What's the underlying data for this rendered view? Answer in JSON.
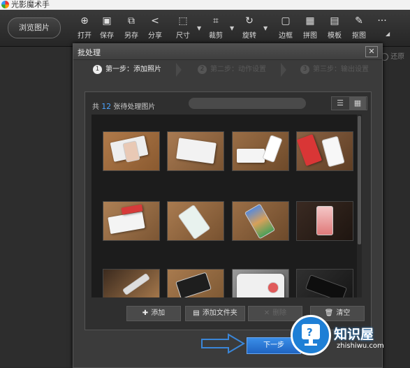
{
  "app": {
    "title": "光影魔术手"
  },
  "toolbar": {
    "browse_label": "浏览图片",
    "tools": [
      {
        "label": "打开",
        "icon": "open-icon",
        "glyph": "⊕"
      },
      {
        "label": "保存",
        "icon": "save-icon",
        "glyph": "▣"
      },
      {
        "label": "另存",
        "icon": "save-as-icon",
        "glyph": "⧉"
      },
      {
        "label": "分享",
        "icon": "share-icon",
        "glyph": "<"
      },
      {
        "label": "尺寸",
        "icon": "resize-icon",
        "glyph": "⬚"
      },
      {
        "label": "裁剪",
        "icon": "crop-icon",
        "glyph": "⌗"
      },
      {
        "label": "旋转",
        "icon": "rotate-icon",
        "glyph": "↻"
      },
      {
        "label": "边框",
        "icon": "frame-icon",
        "glyph": "▢"
      },
      {
        "label": "拼图",
        "icon": "collage-icon",
        "glyph": "▦"
      },
      {
        "label": "模板",
        "icon": "template-icon",
        "glyph": "▤"
      },
      {
        "label": "抠图",
        "icon": "cutout-icon",
        "glyph": "✎"
      }
    ],
    "more_glyph": "···"
  },
  "side_hint": "还原",
  "dialog": {
    "title": "批处理",
    "close_glyph": "✕",
    "steps": [
      {
        "num": "1",
        "label": "第一步：添加照片"
      },
      {
        "num": "2",
        "label": "第二步：动作设置"
      },
      {
        "num": "3",
        "label": "第三步：输出设置"
      }
    ],
    "count_prefix": "共",
    "count_value": "12",
    "count_suffix": "张待处理图片",
    "view_list_glyph": "☰",
    "view_grid_glyph": "▦",
    "buttons": {
      "add": "添加",
      "add_folder": "添加文件夹",
      "delete": "删除",
      "clear": "清空"
    },
    "next_label": "下一步"
  },
  "watermark": {
    "title": "知识屋",
    "sub": "zhishiwu.com",
    "glyph": "?"
  }
}
